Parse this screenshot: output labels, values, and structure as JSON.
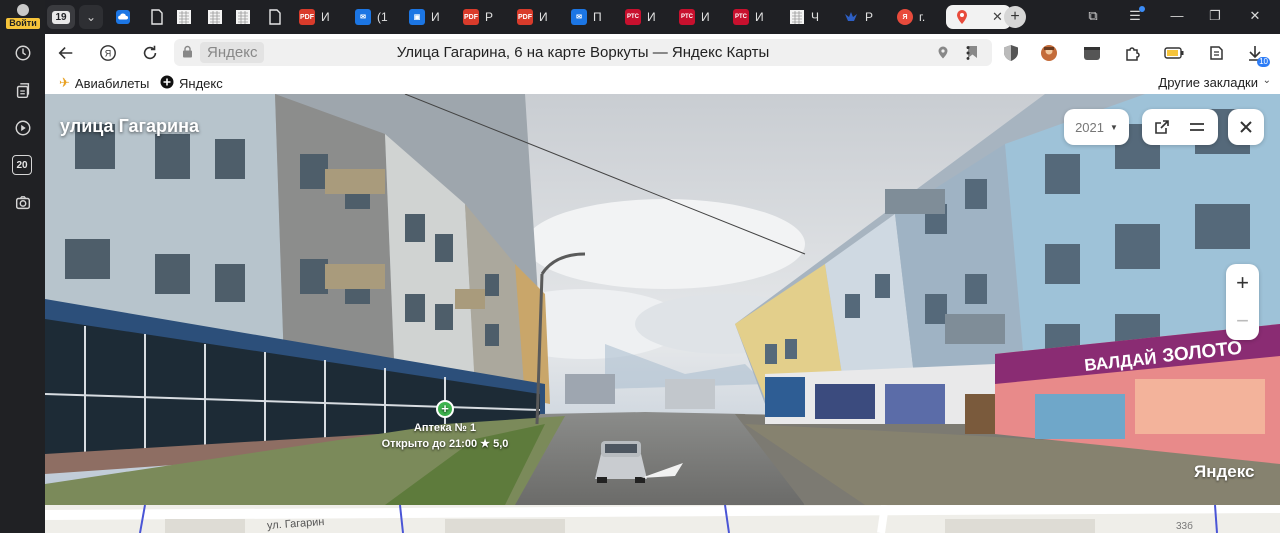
{
  "sidebar": {
    "login_label": "Войти",
    "counter_badge": "20",
    "items": [
      "history-icon",
      "collections-icon",
      "video-icon",
      "counter-badge",
      "screenshot-icon"
    ]
  },
  "tabs": {
    "count_badge": "19",
    "items": [
      {
        "label": "",
        "icon": "cloud-icon",
        "color": "#1c76e4"
      },
      {
        "label": "",
        "icon": "doc-icon",
        "color": "#e6e6e6"
      },
      {
        "label": "",
        "icon": "doc-icon",
        "color": "#e6e6e6"
      },
      {
        "label": "",
        "icon": "doc-icon",
        "color": "#e6e6e6"
      },
      {
        "label": "",
        "icon": "doc-icon",
        "color": "#e6e6e6"
      },
      {
        "label": "",
        "icon": "doc-icon",
        "color": "#e6e6e6"
      },
      {
        "label": "И",
        "icon": "pdf-icon",
        "color": "#d93b2b"
      },
      {
        "label": "(1",
        "icon": "mail-icon",
        "color": "#1c76e4"
      },
      {
        "label": "И",
        "icon": "image-icon",
        "color": "#1c76e4"
      },
      {
        "label": "Р",
        "icon": "pdf-icon",
        "color": "#d93b2b"
      },
      {
        "label": "И",
        "icon": "pdf-icon",
        "color": "#d93b2b"
      },
      {
        "label": "П",
        "icon": "mail-icon",
        "color": "#1c76e4"
      },
      {
        "label": "И",
        "icon": "rts-icon",
        "color": "#c8102e"
      },
      {
        "label": "И",
        "icon": "rts-icon",
        "color": "#c8102e"
      },
      {
        "label": "И",
        "icon": "rts-icon",
        "color": "#c8102e"
      },
      {
        "label": "Ч",
        "icon": "doc-icon",
        "color": "#e6e6e6"
      },
      {
        "label": "Р",
        "icon": "bird-icon",
        "color": "#2d5fc4"
      },
      {
        "label": "г.",
        "icon": "yandex-icon",
        "color": "#e84b3c"
      }
    ],
    "active": {
      "label": "",
      "icon": "maps-pin-icon",
      "color": "#e84b3c"
    }
  },
  "addressbar": {
    "site": "Яндекс",
    "title": "Улица Гагарина, 6 на карте Воркуты — Яндекс Карты",
    "downloads_badge": "10"
  },
  "bookmarks": {
    "items": [
      {
        "label": "Авиабилеты",
        "icon": "plane-icon"
      },
      {
        "label": "Яндекс",
        "icon": "plus-circle-icon"
      }
    ],
    "other": "Другие закладки"
  },
  "panorama": {
    "street_title": "улица Гагарина",
    "year": "2021",
    "poi": {
      "name": "Аптека № 1",
      "status": "Открыто до 21:00",
      "rating": "★ 5,0"
    },
    "shop_signs": [
      "ВАЛДАЙ",
      "ЗОЛОТО"
    ],
    "watermark": "Яндекс",
    "zoom_in": "+",
    "zoom_out": "−"
  },
  "map": {
    "street_label": "ул. Гагарин",
    "building_number": "33б"
  }
}
